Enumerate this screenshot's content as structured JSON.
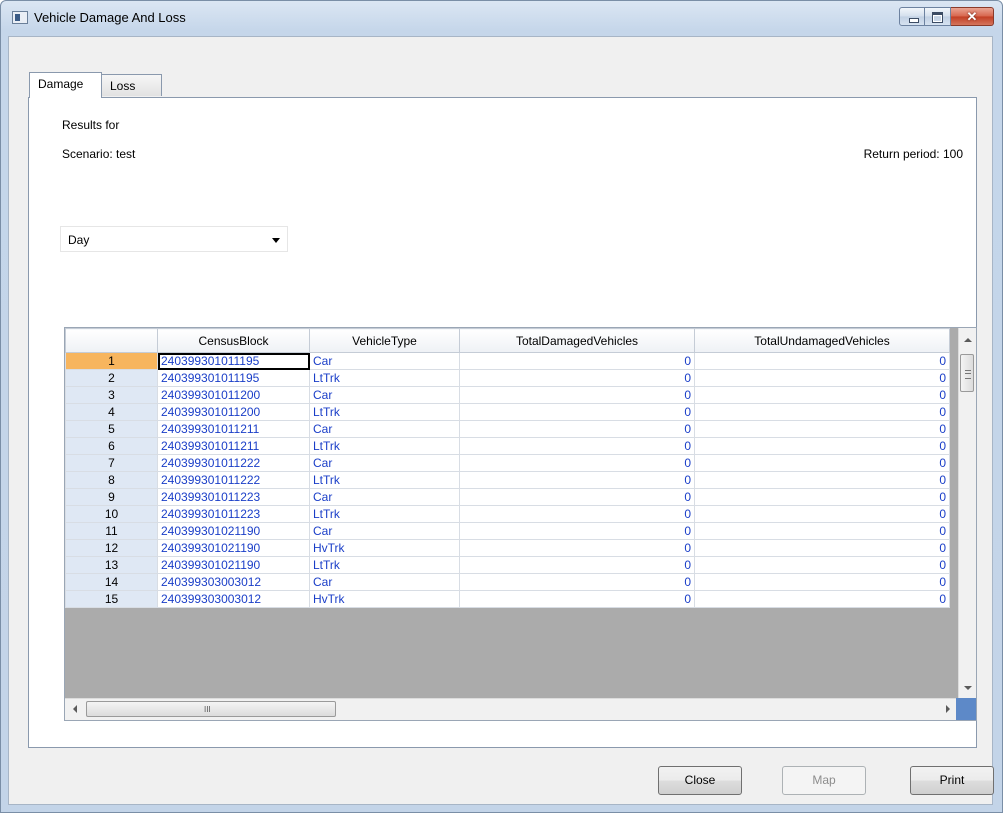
{
  "window": {
    "title": "Vehicle Damage And Loss"
  },
  "tabs": [
    {
      "label": "Damage",
      "active": true
    },
    {
      "label": "Loss",
      "active": false
    }
  ],
  "header": {
    "results_for": "Results for",
    "scenario": "Scenario: test",
    "return_period": "Return period: 100"
  },
  "time_select": {
    "value": "Day"
  },
  "grid": {
    "columns": [
      "CensusBlock",
      "VehicleType",
      "TotalDamagedVehicles",
      "TotalUndamagedVehicles"
    ],
    "rows": [
      {
        "num": "1",
        "census_block": "240399301011195",
        "vehicle_type": "Car",
        "damaged": "0",
        "undamaged": "0"
      },
      {
        "num": "2",
        "census_block": "240399301011195",
        "vehicle_type": "LtTrk",
        "damaged": "0",
        "undamaged": "0"
      },
      {
        "num": "3",
        "census_block": "240399301011200",
        "vehicle_type": "Car",
        "damaged": "0",
        "undamaged": "0"
      },
      {
        "num": "4",
        "census_block": "240399301011200",
        "vehicle_type": "LtTrk",
        "damaged": "0",
        "undamaged": "0"
      },
      {
        "num": "5",
        "census_block": "240399301011211",
        "vehicle_type": "Car",
        "damaged": "0",
        "undamaged": "0"
      },
      {
        "num": "6",
        "census_block": "240399301011211",
        "vehicle_type": "LtTrk",
        "damaged": "0",
        "undamaged": "0"
      },
      {
        "num": "7",
        "census_block": "240399301011222",
        "vehicle_type": "Car",
        "damaged": "0",
        "undamaged": "0"
      },
      {
        "num": "8",
        "census_block": "240399301011222",
        "vehicle_type": "LtTrk",
        "damaged": "0",
        "undamaged": "0"
      },
      {
        "num": "9",
        "census_block": "240399301011223",
        "vehicle_type": "Car",
        "damaged": "0",
        "undamaged": "0"
      },
      {
        "num": "10",
        "census_block": "240399301011223",
        "vehicle_type": "LtTrk",
        "damaged": "0",
        "undamaged": "0"
      },
      {
        "num": "11",
        "census_block": "240399301021190",
        "vehicle_type": "Car",
        "damaged": "0",
        "undamaged": "0"
      },
      {
        "num": "12",
        "census_block": "240399301021190",
        "vehicle_type": "HvTrk",
        "damaged": "0",
        "undamaged": "0"
      },
      {
        "num": "13",
        "census_block": "240399301021190",
        "vehicle_type": "LtTrk",
        "damaged": "0",
        "undamaged": "0"
      },
      {
        "num": "14",
        "census_block": "240399303003012",
        "vehicle_type": "Car",
        "damaged": "0",
        "undamaged": "0"
      },
      {
        "num": "15",
        "census_block": "240399303003012",
        "vehicle_type": "HvTrk",
        "damaged": "0",
        "undamaged": "0"
      }
    ],
    "hscroll_grip": "III"
  },
  "buttons": {
    "close": "Close",
    "map": "Map",
    "print": "Print"
  },
  "colors": {
    "cell_text": "#1a3ec8",
    "sorted_header": "#f7b55e",
    "row_header": "#dfe8f4"
  }
}
